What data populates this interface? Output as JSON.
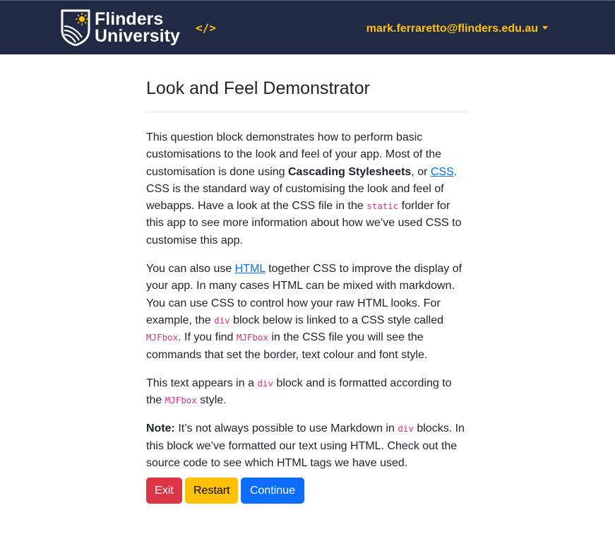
{
  "header": {
    "brand_line1": "Flinders",
    "brand_line2": "University",
    "code_icon": "</>",
    "user_email": "mark.ferraretto@flinders.edu.au"
  },
  "page": {
    "title": "Look and Feel Demonstrator",
    "p1": {
      "t1": "This question block demonstrates how to perform basic customisations to the look and feel of your app. Most of the customisation is done using ",
      "bold": "Cascading Stylesheets",
      "t2": ", or ",
      "link": "CSS",
      "t3": ". CSS is the standard way of customising the look and feel of webapps. Have a look at the CSS file in the ",
      "code": "static",
      "t4": " forlder for this app to see more information about how we’ve used CSS to customise this app."
    },
    "p2": {
      "t1": "You can also use ",
      "link": "HTML",
      "t2": " together CSS to improve the display of your app. In many cases HTML can be mixed with markdown. You can use CSS to control how your raw HTML looks. For example, the ",
      "code1": "div",
      "t3": " block below is linked to a CSS style called ",
      "code2": "MJFbox",
      "t4": ". If you find ",
      "code3": "MJFbox",
      "t5": " in the CSS file you will see the commands that set the border, text colour and font style."
    },
    "box": {
      "t1": "This text appears in a ",
      "code1": "div",
      "t2": " block and is formatted according to the ",
      "code2": "MJFbox",
      "t3": " style."
    },
    "note": {
      "bold": "Note:",
      "t1": " It’s not always possible to use Markdown in ",
      "code": "div",
      "t2": " blocks. In this block we’ve formatted our text using HTML. Check out the source code to see which HTML tags we have used."
    }
  },
  "buttons": {
    "exit": "Exit",
    "restart": "Restart",
    "continue": "Continue"
  },
  "colors": {
    "navbar": "#212a45",
    "accent": "#ffc107",
    "exit": "#dc3545",
    "continue": "#0d6efd"
  },
  "icons": {
    "logo": "flinders-shield-icon",
    "code": "code-icon",
    "caret": "caret-down-icon"
  }
}
